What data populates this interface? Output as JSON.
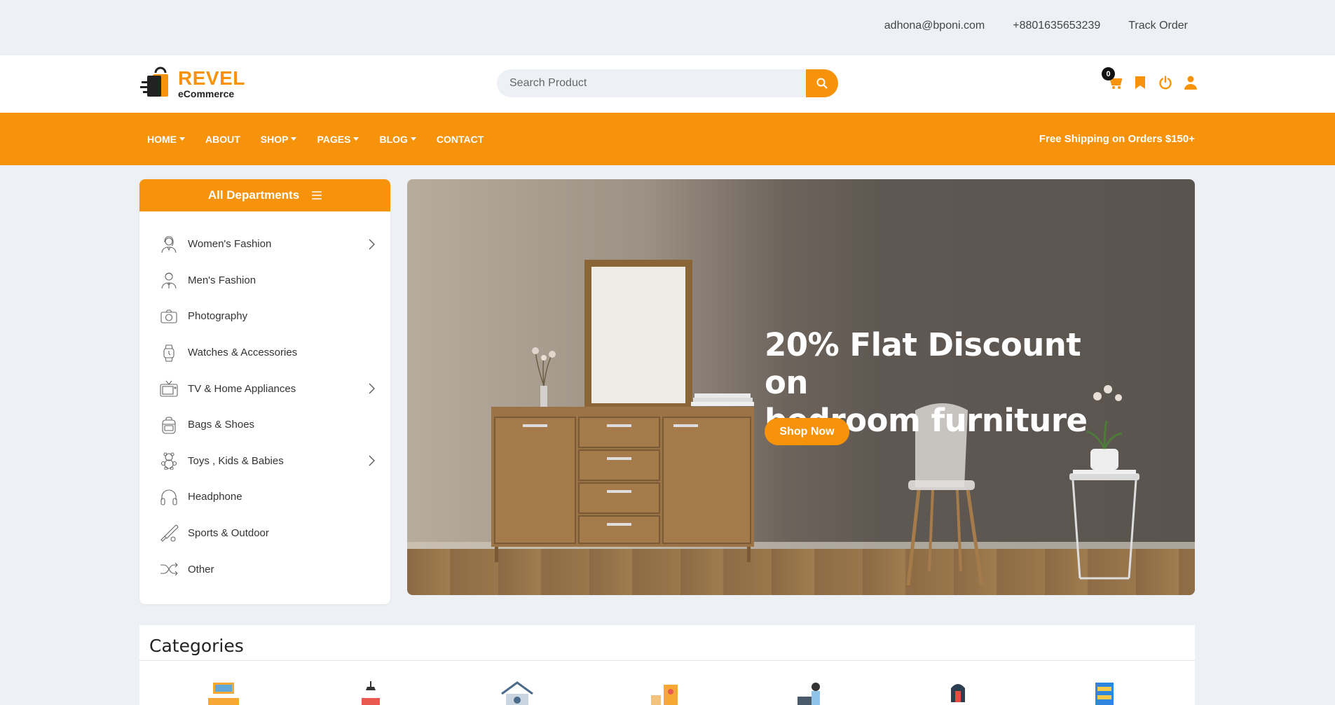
{
  "topbar": {
    "email": "adhona@bponi.com",
    "phone": "+8801635653239",
    "track_order": "Track Order"
  },
  "header": {
    "logo_title": "REVEL",
    "logo_subtitle": "eCommerce",
    "search_placeholder": "Search Product",
    "cart_count": "0",
    "icons": [
      "cart-icon",
      "bookmark-icon",
      "power-icon",
      "user-icon"
    ]
  },
  "nav": {
    "items": [
      {
        "label": "HOME",
        "dropdown": true
      },
      {
        "label": "ABOUT",
        "dropdown": false
      },
      {
        "label": "SHOP",
        "dropdown": true
      },
      {
        "label": "PAGES",
        "dropdown": true
      },
      {
        "label": "BLOG",
        "dropdown": true
      },
      {
        "label": "CONTACT",
        "dropdown": false
      }
    ],
    "promo": "Free Shipping on Orders $150+"
  },
  "departments": {
    "title": "All Departments",
    "items": [
      {
        "label": "Women's Fashion",
        "icon": "woman-icon",
        "submenu": true
      },
      {
        "label": "Men's Fashion",
        "icon": "man-icon",
        "submenu": false
      },
      {
        "label": "Photography",
        "icon": "camera-icon",
        "submenu": false
      },
      {
        "label": "Watches & Accessories",
        "icon": "watch-icon",
        "submenu": false
      },
      {
        "label": "TV & Home Appliances",
        "icon": "tv-icon",
        "submenu": true
      },
      {
        "label": "Bags & Shoes",
        "icon": "bag-icon",
        "submenu": false
      },
      {
        "label": "Toys , Kids & Babies",
        "icon": "teddy-bear-icon",
        "submenu": true
      },
      {
        "label": "Headphone",
        "icon": "headphone-icon",
        "submenu": false
      },
      {
        "label": "Sports & Outdoor",
        "icon": "bat-icon",
        "submenu": false
      },
      {
        "label": "Other",
        "icon": "shuffle-icon",
        "submenu": false
      }
    ]
  },
  "hero": {
    "headline_line1": "20% Flat Discount on",
    "headline_line2": "bedroom furniture",
    "cta": "Shop Now"
  },
  "categories": {
    "title": "Categories"
  },
  "colors": {
    "accent": "#f7930a",
    "background": "#edf1f5"
  }
}
